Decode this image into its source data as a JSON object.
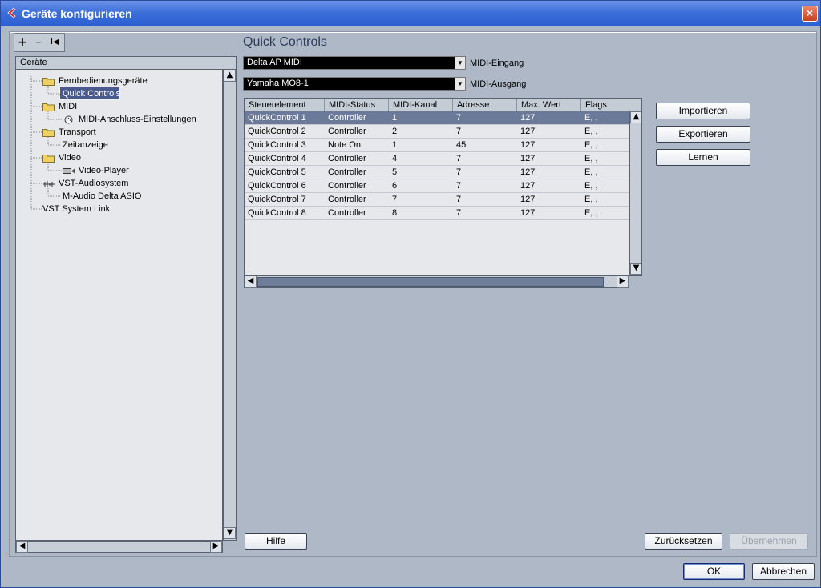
{
  "window": {
    "title": "Geräte konfigurieren",
    "close_label": "×"
  },
  "toolbar": {
    "add_label": "+",
    "remove_label": "–",
    "reset_label": "I◀"
  },
  "tree": {
    "header": "Geräte",
    "items": [
      {
        "label": "Fernbedienungsgeräte",
        "icon": "folder-icon"
      },
      {
        "label": "Quick Controls",
        "icon": "none",
        "selected": true
      },
      {
        "label": "MIDI",
        "icon": "folder-icon"
      },
      {
        "label": "MIDI-Anschluss-Einstellungen",
        "icon": "midi-port-icon"
      },
      {
        "label": "Transport",
        "icon": "folder-icon"
      },
      {
        "label": "Zeitanzeige",
        "icon": "none"
      },
      {
        "label": "Video",
        "icon": "folder-icon"
      },
      {
        "label": "Video-Player",
        "icon": "video-player-icon"
      },
      {
        "label": "VST-Audiosystem",
        "icon": "audio-system-icon"
      },
      {
        "label": "M-Audio Delta ASIO",
        "icon": "none"
      },
      {
        "label": "VST System Link",
        "icon": "none"
      }
    ]
  },
  "panel": {
    "title": "Quick Controls",
    "midi_input": {
      "value": "Delta AP MIDI",
      "label": "MIDI-Eingang"
    },
    "midi_output": {
      "value": "Yamaha MO8-1",
      "label": "MIDI-Ausgang"
    },
    "table": {
      "columns": [
        "Steuerelement",
        "MIDI-Status",
        "MIDI-Kanal",
        "Adresse",
        "Max. Wert",
        "Flags"
      ],
      "rows": [
        [
          "QuickControl 1",
          "Controller",
          "1",
          "7",
          "127",
          "E, ,"
        ],
        [
          "QuickControl 2",
          "Controller",
          "2",
          "7",
          "127",
          "E, ,"
        ],
        [
          "QuickControl 3",
          "Note On",
          "1",
          "45",
          "127",
          "E, ,"
        ],
        [
          "QuickControl 4",
          "Controller",
          "4",
          "7",
          "127",
          "E, ,"
        ],
        [
          "QuickControl 5",
          "Controller",
          "5",
          "7",
          "127",
          "E, ,"
        ],
        [
          "QuickControl 6",
          "Controller",
          "6",
          "7",
          "127",
          "E, ,"
        ],
        [
          "QuickControl 7",
          "Controller",
          "7",
          "7",
          "127",
          "E, ,"
        ],
        [
          "QuickControl 8",
          "Controller",
          "8",
          "7",
          "127",
          "E, ,"
        ]
      ]
    },
    "buttons": {
      "import": "Importieren",
      "export": "Exportieren",
      "learn": "Lernen",
      "help": "Hilfe",
      "reset": "Zurücksetzen",
      "apply": "Übernehmen"
    }
  },
  "footer": {
    "ok": "OK",
    "cancel": "Abbrechen"
  },
  "colors": {
    "titlebar": "#2c5fd1",
    "window_bg": "#aeb8c6",
    "selection": "#6a7a98"
  }
}
